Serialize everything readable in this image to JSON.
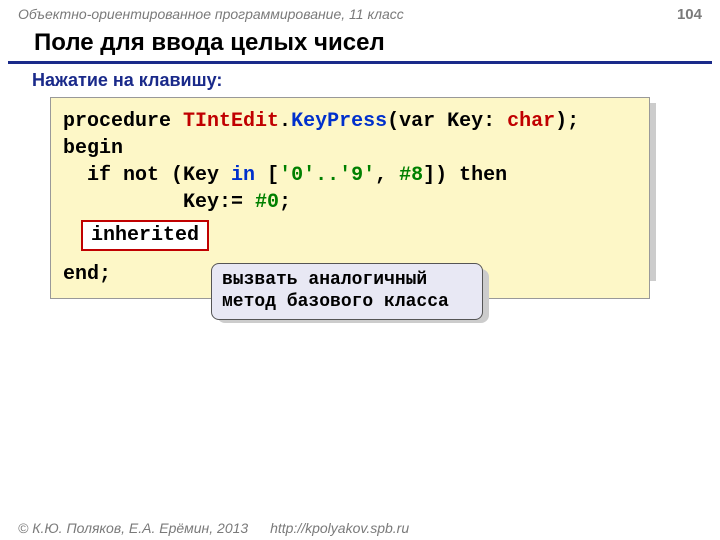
{
  "header": {
    "left": "Объектно-ориентированное программирование, 11 класс",
    "page": "104"
  },
  "title": "Поле для ввода целых чисел",
  "subtitle": "Нажатие на клавишу:",
  "code": {
    "l1_procedure": "procedure ",
    "l1_class": "TIntEdit",
    "l1_dot": ".",
    "l1_method": "KeyPress",
    "l1_open": "(var Key: ",
    "l1_type": "char",
    "l1_close": ");",
    "l2": "begin",
    "l3a": "  if not (Key ",
    "l3_in": "in",
    "l3b": " [",
    "l3_str": "'0'..'9'",
    "l3c": ", ",
    "l3_hash8": "#8",
    "l3d": "]) then",
    "l4a": "          Key:= ",
    "l4_hash0": "#0",
    "l4b": ";",
    "inherited": "inherited",
    "l6": "end;"
  },
  "callout": "вызвать аналогичный метод базового класса",
  "footer": {
    "copyright": "© К.Ю. Поляков, Е.А. Ерёмин, 2013",
    "url": "http://kpolyakov.spb.ru"
  }
}
